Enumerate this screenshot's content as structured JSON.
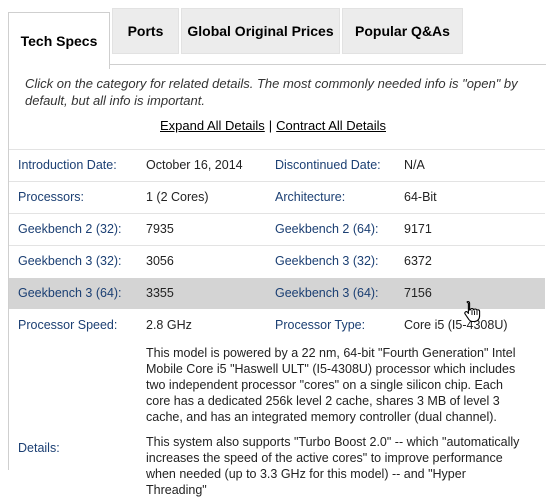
{
  "tabs": [
    {
      "label": "Tech Specs"
    },
    {
      "label": "Ports"
    },
    {
      "label": "Global Original Prices"
    },
    {
      "label": "Popular Q&As"
    }
  ],
  "intro": "Click on the category for related details. The most commonly needed info is \"open\" by default, but all info is important.",
  "links": {
    "expand": "Expand All Details",
    "separator": "|",
    "contract": "Contract All Details"
  },
  "rows": [
    {
      "l1": "Introduction Date:",
      "v1": "October 16, 2014",
      "l2": "Discontinued Date:",
      "v2": "N/A"
    },
    {
      "l1": "Processors:",
      "v1": "1 (2 Cores)",
      "l2": "Architecture:",
      "v2": "64-Bit"
    },
    {
      "l1": "Geekbench 2 (32):",
      "v1": "7935",
      "l2": "Geekbench 2 (64):",
      "v2": "9171"
    },
    {
      "l1": "Geekbench 3 (32):",
      "v1": "3056",
      "l2": "Geekbench 3 (32):",
      "v2": "6372"
    },
    {
      "l1": "Geekbench 3 (64):",
      "v1": "3355",
      "l2": "Geekbench 3 (64):",
      "v2": "7156"
    },
    {
      "l1": "Processor Speed:",
      "v1": "2.8 GHz",
      "l2": "Processor Type:",
      "v2": "Core i5 (I5-4308U)"
    }
  ],
  "details": {
    "label": "Details:",
    "para1": "This model is powered by a 22 nm, 64-bit \"Fourth Generation\" Intel Mobile Core i5 \"Haswell ULT\" (I5-4308U) processor which includes two independent processor \"cores\" on a single silicon chip. Each core has a dedicated 256k level 2 cache, shares 3 MB of level 3 cache, and has an integrated memory controller (dual channel).",
    "para2": "This system also supports \"Turbo Boost 2.0\" -- which \"automatically increases the speed of the active cores\" to improve performance when needed (up to 3.3 GHz for this model) -- and \"Hyper Threading\""
  },
  "colors": {
    "label_blue": "#1b3f73",
    "highlight_row": "#d4d4d4",
    "tab_bg": "#ececec"
  },
  "cursor_icon": "hand-pointer-icon"
}
